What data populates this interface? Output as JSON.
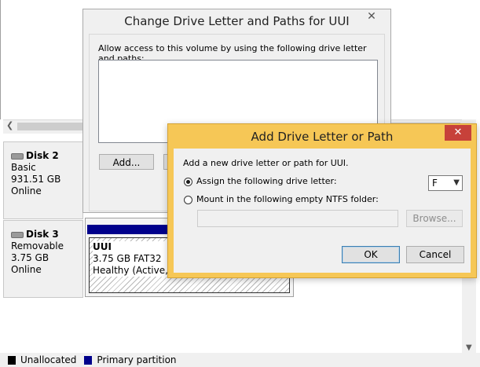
{
  "background": {
    "disks": [
      {
        "name": "Disk 2",
        "type": "Basic",
        "size": "931.51 GB",
        "status": "Online"
      },
      {
        "name": "Disk 3",
        "type": "Removable",
        "size": "3.75 GB",
        "status": "Online"
      }
    ],
    "partition": {
      "name": "UUI",
      "detail": "3.75 GB FAT32",
      "status": "Healthy (Active, Pr"
    },
    "legend": [
      {
        "label": "Unallocated",
        "color": "#000000"
      },
      {
        "label": "Primary partition",
        "color": "#00008b"
      }
    ]
  },
  "back_dialog": {
    "title": "Change Drive Letter and Paths for UUI",
    "close_glyph": "✕",
    "instruction": "Allow access to this volume by using the following drive letter and paths:",
    "add_button": "Add..."
  },
  "front_dialog": {
    "title": "Add Drive Letter or Path",
    "close_glyph": "✕",
    "instruction": "Add a new drive letter or path for UUI.",
    "option_assign": "Assign the following drive letter:",
    "option_mount": "Mount in the following empty NTFS folder:",
    "drive_letter": "F",
    "browse_button": "Browse...",
    "ok_button": "OK",
    "cancel_button": "Cancel"
  }
}
